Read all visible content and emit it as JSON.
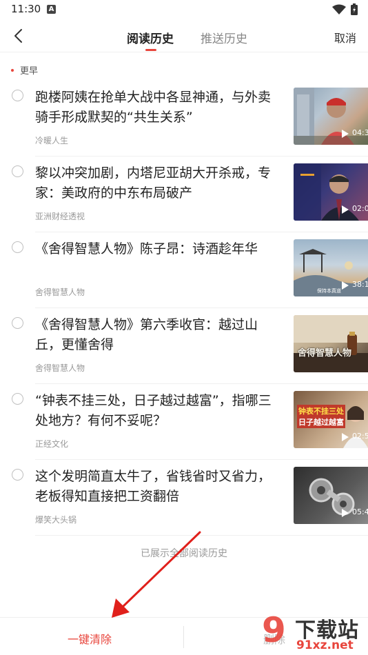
{
  "status_bar": {
    "time": "11:30",
    "notification_icon": "a-icon"
  },
  "nav": {
    "back_icon": "chevron-left-icon",
    "tabs": [
      {
        "label": "阅读历史",
        "active": true
      },
      {
        "label": "推送历史",
        "active": false
      }
    ],
    "cancel_label": "取消"
  },
  "section_label": "更早",
  "items": [
    {
      "title": "跑楼阿姨在抢单大战中各显神通，与外卖骑手形成默契的“共生关系”",
      "source": "冷暖人生",
      "duration": "04:3",
      "thumb_colors": [
        "#7f93a6",
        "#c9b7a3"
      ]
    },
    {
      "title": "黎以冲突加剧，内塔尼亚胡大开杀戒，专家：美政府的中东布局破产",
      "source": "亚洲财经透视",
      "duration": "02:0",
      "thumb_colors": [
        "#2b2a5a",
        "#7a4a6a"
      ]
    },
    {
      "title": "《舍得智慧人物》陈子昂：诗酒趁年华",
      "source": "舍得智慧人物",
      "duration": "38:1",
      "thumb_colors": [
        "#9fb6c8",
        "#c8a67d"
      ],
      "thumb_text": "保持本真道"
    },
    {
      "title": "《舍得智慧人物》第六季收官：越过山丘，更懂舍得",
      "source": "舍得智慧人物",
      "duration": "",
      "thumb_colors": [
        "#5a4a3e",
        "#c9b89c"
      ],
      "thumb_text": "舍得智慧人物"
    },
    {
      "title": "“钟表不挂三处，日子越过越富”，指哪三处地方？有何不妥呢？",
      "source": "正经文化",
      "duration": "02:5",
      "thumb_colors": [
        "#6a4a34",
        "#d8c2a8"
      ],
      "thumb_text": "钟表不挂三处",
      "thumb_text2": "日子越过越富"
    },
    {
      "title": "这个发明简直太牛了，省钱省时又省力，老板得知直接把工资翻倍",
      "source": "爆笑大头锅",
      "duration": "05:4",
      "thumb_colors": [
        "#3a3a3a",
        "#9a9a9a"
      ]
    }
  ],
  "all_shown_text": "已展示全部阅读历史",
  "bottom_bar": {
    "clear_all_label": "一键清除",
    "delete_label": "删除"
  },
  "watermark": {
    "logo_text": "9",
    "main_text": "下载站",
    "sub_text": "91xz.net"
  },
  "colors": {
    "accent": "#e8453c",
    "annotation_arrow": "#e0201b"
  }
}
